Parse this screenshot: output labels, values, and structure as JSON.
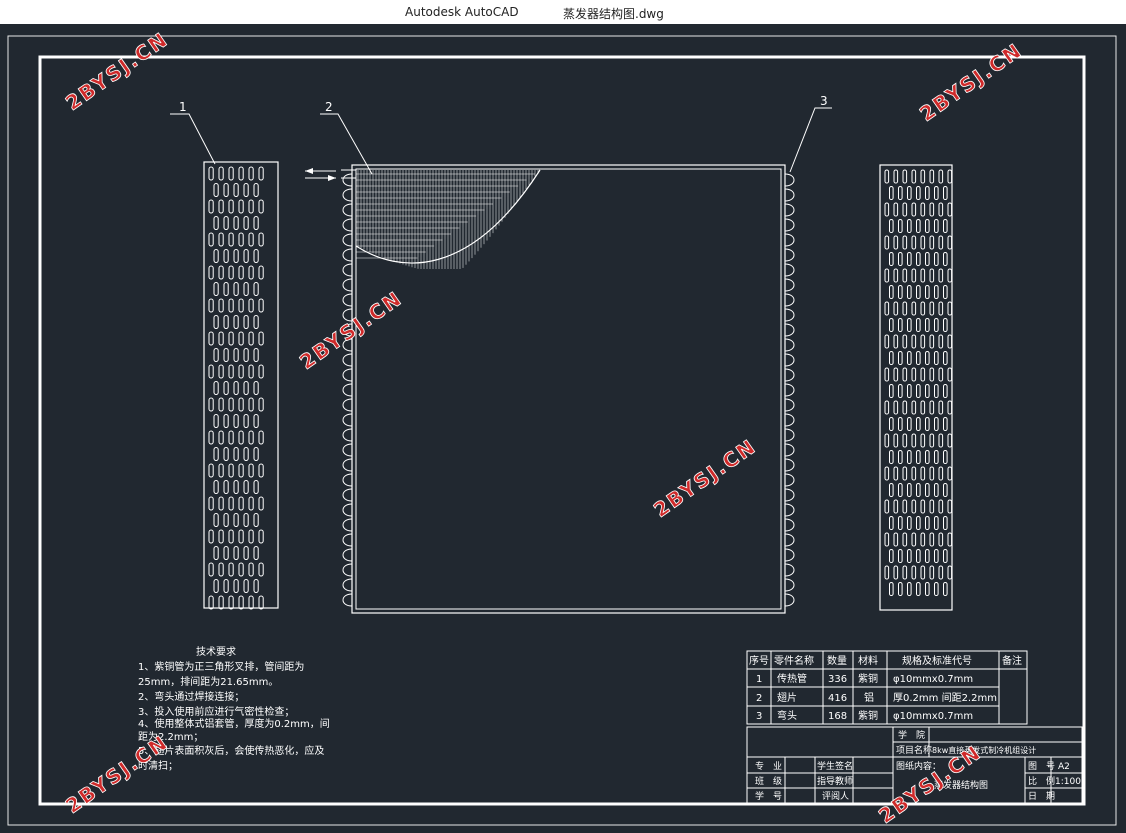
{
  "window": {
    "app_name": "Autodesk AutoCAD",
    "file_name": "蒸发器结构图.dwg"
  },
  "colors": {
    "background": "#212830",
    "lines": "#ffffff",
    "watermark": "#cf2a2a"
  },
  "drawing": {
    "part_labels": [
      "1",
      "2",
      "3"
    ],
    "tech_requirements": {
      "title": "技术要求",
      "lines": [
        "1、紫铜管为正三角形叉排，管间距为",
        "25mm，排间距为21.65mm。",
        "2、弯头通过焊接连接；",
        "3、投入使用前应进行气密性检查；",
        "4、使用整体式铝套管，厚度为0.2mm，间",
        "距为2.2mm；",
        "5、翅片表面积灰后，会使传热恶化，应及",
        "时清扫；"
      ]
    },
    "bom": {
      "headers": [
        "序号",
        "零件名称",
        "数量",
        "材料",
        "规格及标准代号",
        "备注"
      ],
      "rows": [
        [
          "1",
          "传热管",
          "336",
          "紫铜",
          "φ10mmx0.7mm",
          ""
        ],
        [
          "2",
          "翅片",
          "416",
          "铝",
          "厚0.2mm 间距2.2mm",
          ""
        ],
        [
          "3",
          "弯头",
          "168",
          "紫铜",
          "φ10mmx0.7mm",
          ""
        ]
      ]
    },
    "title_block": {
      "school_label": "学　院",
      "project_label": "项目名称",
      "project_value": "8kw直接蒸发式制冷机组设计",
      "content_label": "图纸内容：",
      "content_value": "蒸发器结构图",
      "major_label": "专　业",
      "class_label": "班　级",
      "id_label": "学　号",
      "student_sign_label": "学生签名",
      "advisor_label": "指导教师",
      "reviewer_label": "评阅人",
      "drawing_no_label": "图　号",
      "drawing_no_value": "A2",
      "scale_label": "比　例",
      "scale_value": "1:100",
      "date_label": "日　期"
    },
    "watermark_text": "2BYSJ.CN"
  }
}
